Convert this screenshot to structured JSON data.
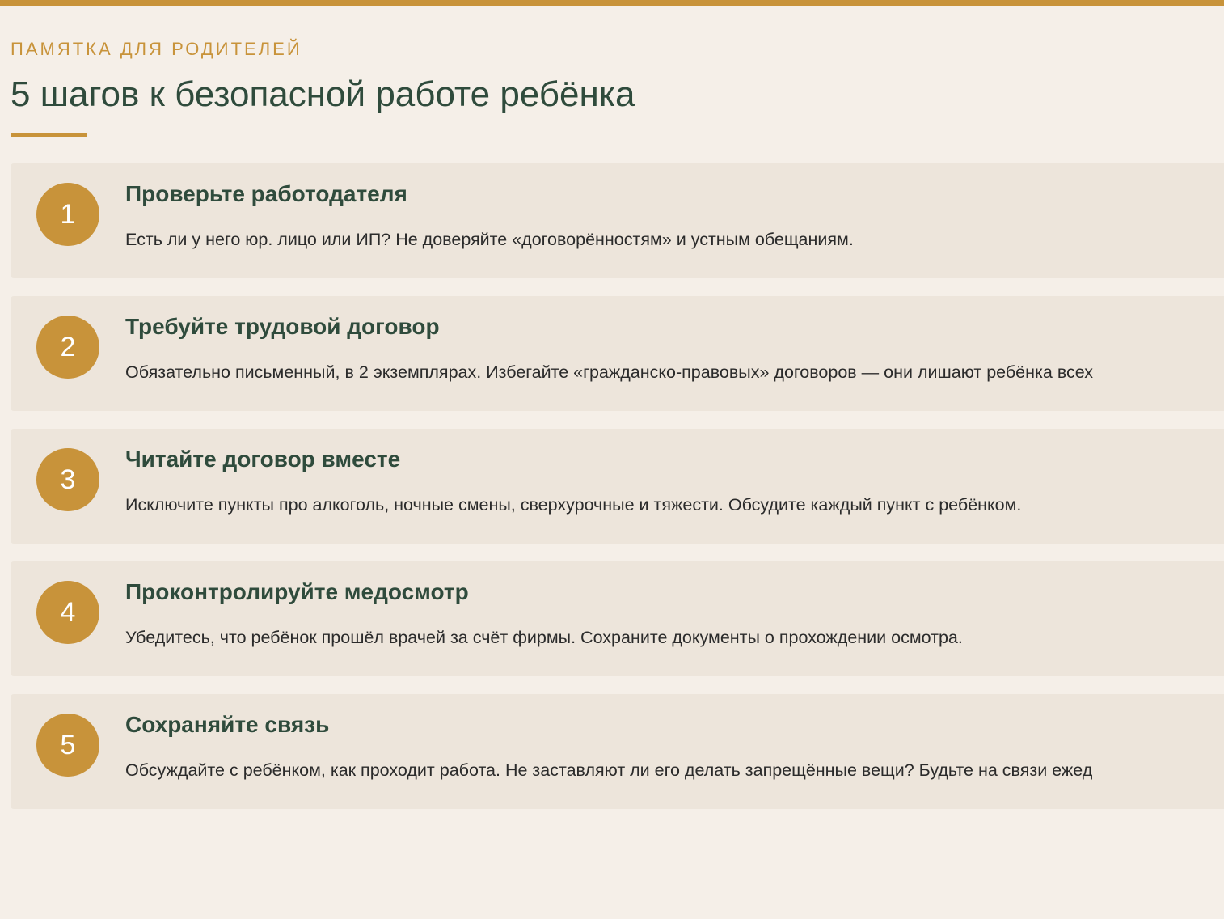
{
  "header": {
    "eyebrow": "ПАМЯТКА ДЛЯ РОДИТЕЛЕЙ",
    "title": "5 шагов к безопасной работе ребёнка"
  },
  "colors": {
    "accent": "#c8933a",
    "heading": "#2f4b3c",
    "background": "#f5efe8",
    "card": "#ede5db"
  },
  "steps": [
    {
      "number": "1",
      "title": "Проверьте работодателя",
      "text": "Есть ли у него юр. лицо или ИП? Не доверяйте «договорённостям» и устным обещаниям."
    },
    {
      "number": "2",
      "title": "Требуйте трудовой договор",
      "text": "Обязательно письменный, в 2 экземплярах. Избегайте «гражданско-правовых» договоров — они лишают ребёнка всех"
    },
    {
      "number": "3",
      "title": "Читайте договор вместе",
      "text": "Исключите пункты про алкоголь, ночные смены, сверхурочные и тяжести. Обсудите каждый пункт с ребёнком."
    },
    {
      "number": "4",
      "title": "Проконтролируйте медосмотр",
      "text": "Убедитесь, что ребёнок прошёл врачей за счёт фирмы. Сохраните документы о прохождении осмотра."
    },
    {
      "number": "5",
      "title": "Сохраняйте связь",
      "text": "Обсуждайте с ребёнком, как проходит работа. Не заставляют ли его делать запрещённые вещи? Будьте на связи ежед"
    }
  ]
}
